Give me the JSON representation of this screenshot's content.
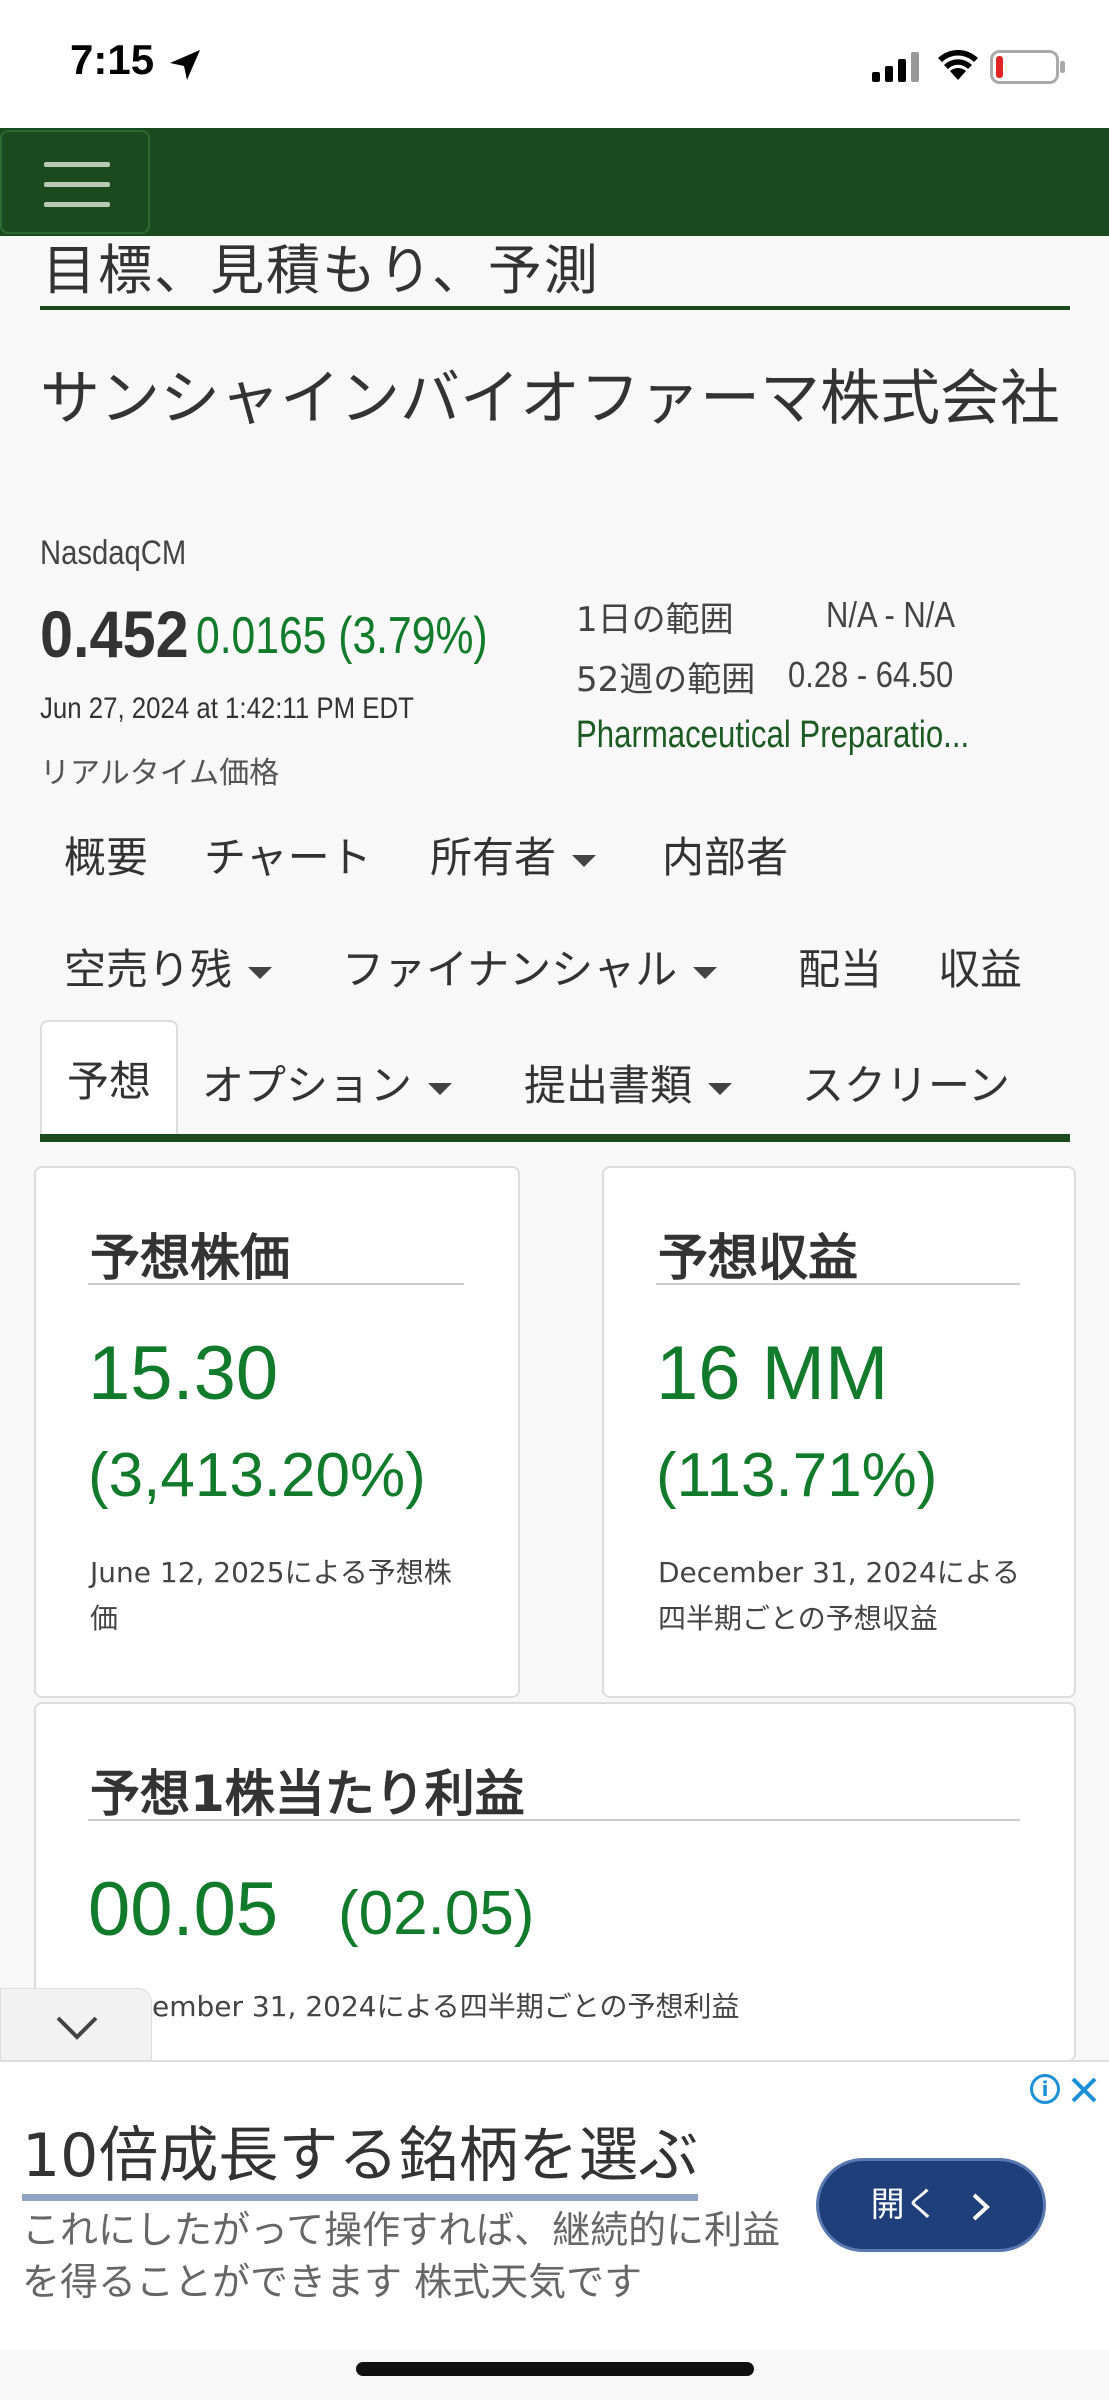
{
  "status_bar": {
    "time": "7:15"
  },
  "section": {
    "heading": "目標、見積もり、予測"
  },
  "company": {
    "name": "サンシャインバイオファーマ株式会社",
    "exchange": "NasdaqCM",
    "price": "0.452",
    "change": "0.0165 (3.79%)",
    "timestamp": "Jun 27, 2024 at 1:42:11 PM EDT",
    "realtime_label": "リアルタイム価格",
    "day_range_label": "1日の範囲",
    "day_range_value": "N/A - N/A",
    "week52_range_label": "52週の範囲",
    "week52_range_value": "0.28 - 64.50",
    "industry": "Pharmaceutical Preparatio..."
  },
  "tabs": [
    {
      "label": "概要",
      "dropdown": false
    },
    {
      "label": "チャート",
      "dropdown": false
    },
    {
      "label": "所有者",
      "dropdown": true
    },
    {
      "label": "内部者",
      "dropdown": false
    },
    {
      "label": "空売り残",
      "dropdown": true
    },
    {
      "label": "ファイナンシャル",
      "dropdown": true
    },
    {
      "label": "配当",
      "dropdown": false
    },
    {
      "label": "収益",
      "dropdown": false
    },
    {
      "label": "予想",
      "dropdown": false,
      "active": true
    },
    {
      "label": "オプション",
      "dropdown": true
    },
    {
      "label": "提出書類",
      "dropdown": true
    },
    {
      "label": "スクリーン",
      "dropdown": false
    }
  ],
  "cards": {
    "price_target": {
      "title": "予想株価",
      "value": "15.30",
      "pct": "(3,413.20%)",
      "note": "June 12, 2025による予想株価"
    },
    "revenue": {
      "title": "予想収益",
      "value": "16 MM",
      "pct": "(113.71%)",
      "note": "December 31, 2024による四半期ごとの予想収益"
    },
    "eps": {
      "title": "予想1株当たり利益",
      "value": "00.05",
      "pct": "(02.05)",
      "note": "ember 31, 2024による四半期ごとの予想利益"
    }
  },
  "ad": {
    "title": "10倍成長する銘柄を選ぶ",
    "description": "これにしたがって操作すれば、継続的に利益を得ることができます 株式天気です",
    "button_label": "開く",
    "info_glyph": "i"
  },
  "colors": {
    "nav_green": "#1c4a1f",
    "value_green": "#117a2b",
    "ad_button": "#1f3f7a"
  }
}
